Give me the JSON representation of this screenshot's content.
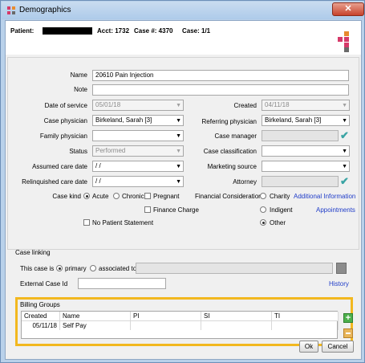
{
  "window": {
    "title": "Demographics",
    "close_label": "✕"
  },
  "header": {
    "patient_label": "Patient:",
    "acct": "Acct: 1732",
    "case_no": "Case #: 4370",
    "case": "Case: 1/1"
  },
  "form": {
    "name_label": "Name",
    "name_value": "20610 Pain Injection",
    "note_label": "Note",
    "note_value": "",
    "date_of_service_label": "Date of service",
    "date_of_service_value": "05/01/18",
    "created_label": "Created",
    "created_value": "04/11/18",
    "case_physician_label": "Case physician",
    "case_physician_value": "Birkeland, Sarah  [3]",
    "referring_physician_label": "Referring physician",
    "referring_physician_value": "Birkeland, Sarah  [3]",
    "family_physician_label": "Family physician",
    "family_physician_value": "",
    "case_manager_label": "Case manager",
    "case_manager_value": "",
    "status_label": "Status",
    "status_value": "Performed",
    "case_classification_label": "Case classification",
    "case_classification_value": "",
    "assumed_care_date_label": "Assumed care date",
    "assumed_care_date_value": " / /",
    "marketing_source_label": "Marketing source",
    "marketing_source_value": "",
    "relinquished_care_date_label": "Relinquished care date",
    "relinquished_care_date_value": " / /",
    "attorney_label": "Attorney",
    "attorney_value": "",
    "case_kind_label": "Case kind",
    "acute_label": "Acute",
    "chronic_label": "Chronic",
    "pregnant_label": "Pregnant",
    "finance_charge_label": "Finance Charge",
    "financial_consideration_label": "Financial Consideration",
    "charity_label": "Charity",
    "indigent_label": "Indigent",
    "other_label": "Other",
    "additional_information_link": "Additional Information",
    "appointments_link": "Appointments",
    "no_patient_statement_label": "No Patient Statement"
  },
  "case_linking": {
    "title": "Case linking",
    "this_case_is_label": "This case is",
    "primary_label": "primary",
    "associated_to_label": "associated to",
    "external_case_id_label": "External Case Id",
    "external_case_id_value": "",
    "history_link": "History"
  },
  "billing_groups": {
    "title": "Billing Groups",
    "columns": [
      "Created",
      "Name",
      "PI",
      "SI",
      "TI"
    ],
    "rows": [
      {
        "created": "05/11/18",
        "name": "Self Pay",
        "pi": "",
        "si": "",
        "ti": ""
      }
    ]
  },
  "buttons": {
    "ok": "Ok",
    "cancel": "Cancel"
  },
  "colors": {
    "highlight_border": "#f2b81f",
    "link": "#1f3cc8",
    "check": "#3aa4a4"
  }
}
